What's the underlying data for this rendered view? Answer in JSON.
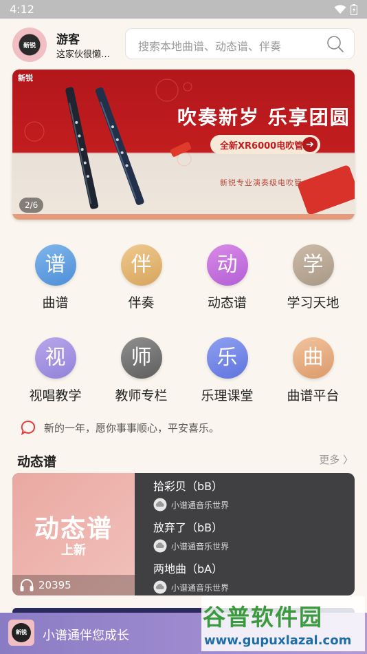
{
  "status_bar": {
    "time": "4:12"
  },
  "user": {
    "avatar_text": "新锐",
    "name": "游客",
    "bio": "这家伙很懒…"
  },
  "search": {
    "placeholder": "搜索本地曲谱、动态谱、伴奏"
  },
  "banner": {
    "logo": "新锐",
    "title": "吹奏新岁 乐享团圆",
    "button_label": "全新XR6000电吹管",
    "subtitle": "新锐专业演奏级电吹管",
    "counter": "2/6"
  },
  "grid": {
    "items": [
      {
        "glyph": "谱",
        "label": "曲谱",
        "color_from": "#7fb6ea",
        "color_to": "#4e8fd9"
      },
      {
        "glyph": "伴",
        "label": "伴奏",
        "color_from": "#efc98e",
        "color_to": "#d7a55d"
      },
      {
        "glyph": "动",
        "label": "动态谱",
        "color_from": "#d98ae6",
        "color_to": "#b35fd6"
      },
      {
        "glyph": "学",
        "label": "学习天地",
        "color_from": "#cdbba8",
        "color_to": "#a89886"
      },
      {
        "glyph": "视",
        "label": "视唱教学",
        "color_from": "#b7a6ea",
        "color_to": "#9283da"
      },
      {
        "glyph": "师",
        "label": "教师专栏",
        "color_from": "#8f8f8f",
        "color_to": "#5e5e5e"
      },
      {
        "glyph": "乐",
        "label": "乐理课堂",
        "color_from": "#8fa0f0",
        "color_to": "#5f74de"
      },
      {
        "glyph": "曲",
        "label": "曲谱平台",
        "color_from": "#f1c39e",
        "color_to": "#dc9a6a"
      }
    ]
  },
  "notice": {
    "text": "新的一年，愿你事事顺心，平安喜乐。"
  },
  "section": {
    "title": "动态谱",
    "more": "更多 〉"
  },
  "dynamic": {
    "cover_big": "动态谱",
    "cover_small": "上新",
    "play_count": "20395",
    "items": [
      {
        "title": "拾彩贝（bB）",
        "source": "小谱通音乐世界"
      },
      {
        "title": "放弃了（bB）",
        "source": "小谱通音乐世界"
      },
      {
        "title": "两地曲（bA）",
        "source": "小谱通音乐世界"
      }
    ]
  },
  "bottom_bar": {
    "avatar_text": "新锐",
    "text": "小谱通伴您成长"
  },
  "watermark": {
    "title": "谷普软件园",
    "url": "www.gupuxlazal.com"
  }
}
